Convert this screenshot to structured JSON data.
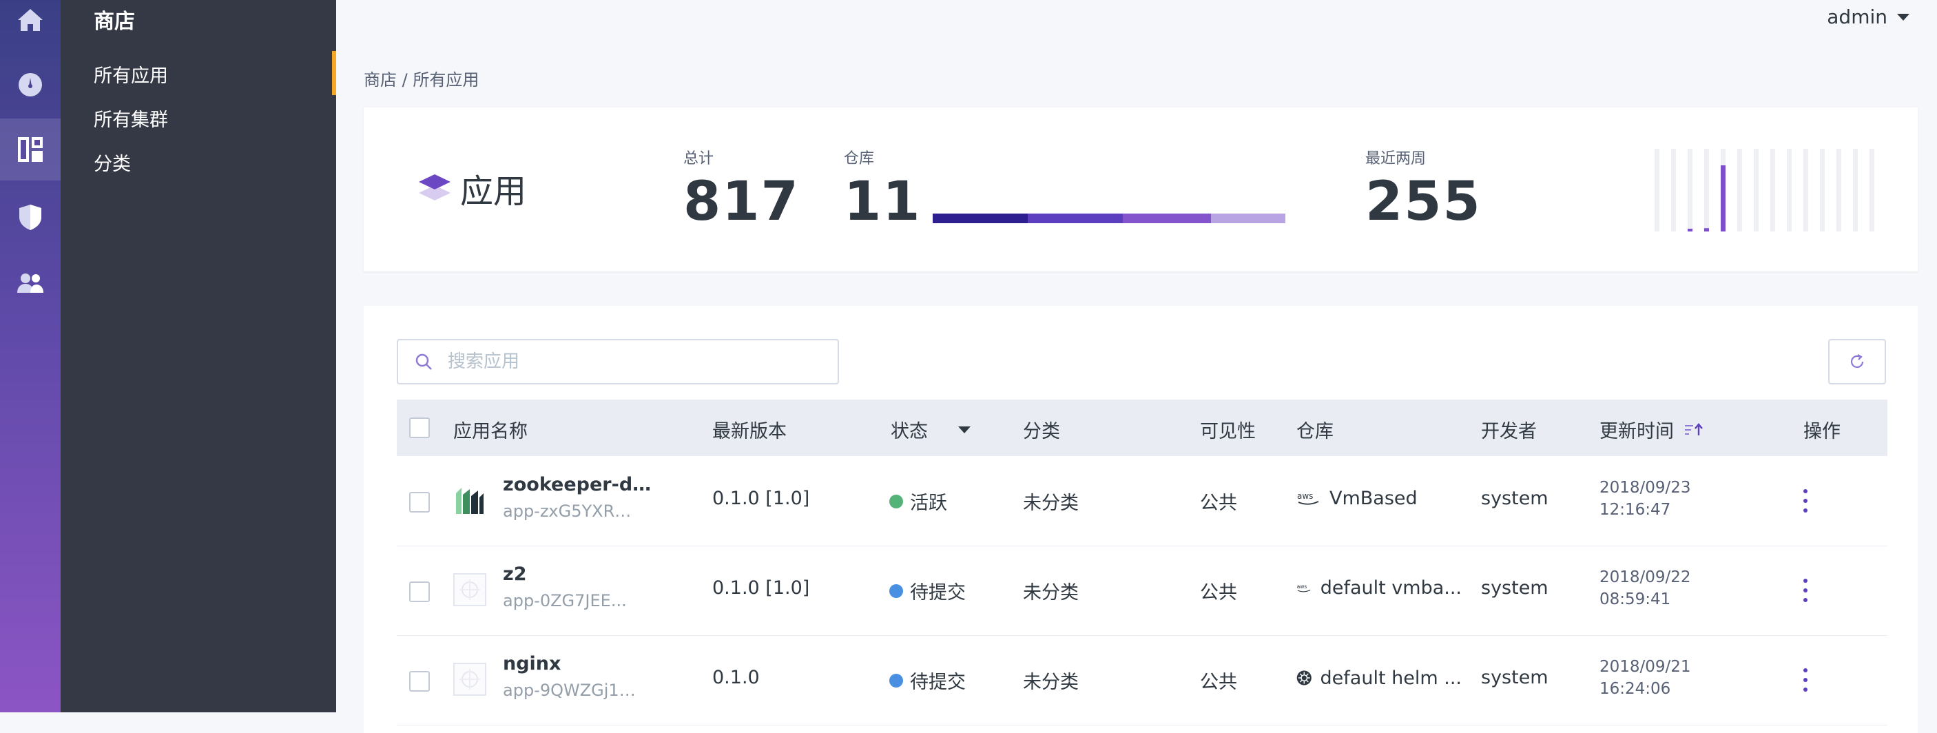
{
  "nav_rail": {
    "items": [
      {
        "icon": "home-icon"
      },
      {
        "icon": "dashboard-gauge-icon"
      },
      {
        "icon": "apps-grid-icon",
        "active": true
      },
      {
        "icon": "shield-icon"
      },
      {
        "icon": "users-icon"
      }
    ]
  },
  "subnav": {
    "title": "商店",
    "items": [
      {
        "label": "所有应用",
        "active": true
      },
      {
        "label": "所有集群"
      },
      {
        "label": "分类"
      }
    ]
  },
  "header": {
    "user": "admin"
  },
  "breadcrumb": "商店 / 所有应用",
  "stats": {
    "title": "应用",
    "total_label": "总计",
    "total_value": "817",
    "repo_label": "仓库",
    "repo_value": "11",
    "recent_label": "最近两周",
    "recent_value": "255",
    "repo_bar_colors": [
      "#2d1f8f",
      "#5c3fbf",
      "#8454cd",
      "#b8a3e3"
    ],
    "repo_bar_fractions": [
      0.27,
      0.27,
      0.25,
      0.21
    ],
    "spark_levels": [
      0.0,
      0.0,
      0.02,
      0.04,
      0.8,
      0.0,
      0.0,
      0.0,
      0.0,
      0.0,
      0.0,
      0.0,
      0.0,
      0.0
    ],
    "spark_color": "#7b50c8",
    "spark_track_color": "#eef0f4"
  },
  "search": {
    "placeholder": "搜索应用"
  },
  "table": {
    "columns": {
      "name": "应用名称",
      "version": "最新版本",
      "status": "状态",
      "category": "分类",
      "visibility": "可见性",
      "repo": "仓库",
      "developer": "开发者",
      "updated": "更新时间",
      "actions": "操作"
    },
    "rows": [
      {
        "name": "zookeeper-dem...",
        "id": "app-zxG5YXRZ...",
        "icon": "zookeeper-logo-icon",
        "version": "0.1.0 [1.0]",
        "status": "活跃",
        "status_color": "#55b37a",
        "category": "未分类",
        "visibility": "公共",
        "repo_icon": "aws-icon",
        "repo": "VmBased",
        "developer": "system",
        "updated_date": "2018/09/23",
        "updated_time": "12:16:47"
      },
      {
        "name": "z2",
        "id": "app-0ZG7JEE...",
        "icon": "placeholder-app-icon",
        "version": "0.1.0 [1.0]",
        "status": "待提交",
        "status_color": "#4a90e2",
        "category": "未分类",
        "visibility": "公共",
        "repo_icon": "aws-icon",
        "repo": "default vmba...",
        "developer": "system",
        "updated_date": "2018/09/22",
        "updated_time": "08:59:41"
      },
      {
        "name": "nginx",
        "id": "app-9QWZGj17...",
        "icon": "placeholder-app-icon",
        "version": "0.1.0",
        "status": "待提交",
        "status_color": "#4a90e2",
        "category": "未分类",
        "visibility": "公共",
        "repo_icon": "kubernetes-helm-icon",
        "repo": "default helm ...",
        "developer": "system",
        "updated_date": "2018/09/21",
        "updated_time": "16:24:06"
      }
    ]
  }
}
